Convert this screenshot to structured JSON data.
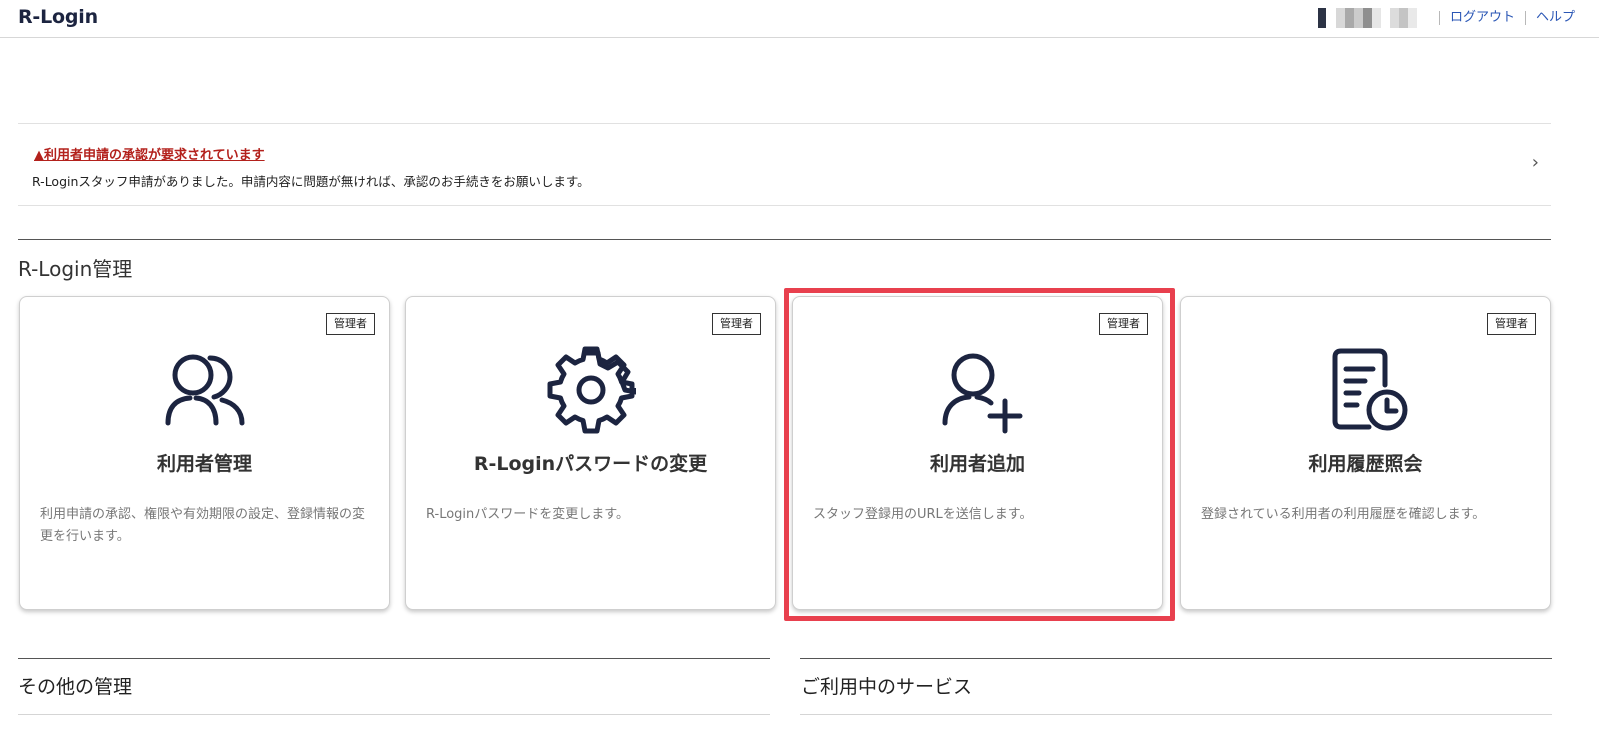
{
  "header": {
    "logo": "R-Login",
    "logout_label": "ログアウト",
    "help_label": "ヘルプ"
  },
  "alert": {
    "title": "▲利用者申請の承認が要求されています",
    "body": "R-Loginスタッフ申請がありました。申請内容に問題が無ければ、承認のお手続きをお願いします。",
    "chevron": "›"
  },
  "section": {
    "title": "R-Login管理"
  },
  "cards": [
    {
      "badge": "管理者",
      "title": "利用者管理",
      "desc": "利用申請の承認、権限や有効期限の設定、登録情報の変更を行います。",
      "icon": "users-icon"
    },
    {
      "badge": "管理者",
      "title": "R-Loginパスワードの変更",
      "desc": "R-Loginパスワードを変更します。",
      "icon": "gear-icon"
    },
    {
      "badge": "管理者",
      "title": "利用者追加",
      "desc": "スタッフ登録用のURLを送信します。",
      "icon": "user-add-icon"
    },
    {
      "badge": "管理者",
      "title": "利用履歴照会",
      "desc": "登録されている利用者の利用履歴を確認します。",
      "icon": "history-document-icon"
    }
  ],
  "bottom": {
    "other_title": "その他の管理",
    "services_title": "ご利用中のサービス"
  },
  "colors": {
    "brand": "#1c2440",
    "link": "#2a56b5",
    "alert": "#b3211c",
    "highlight": "#e8404e"
  }
}
